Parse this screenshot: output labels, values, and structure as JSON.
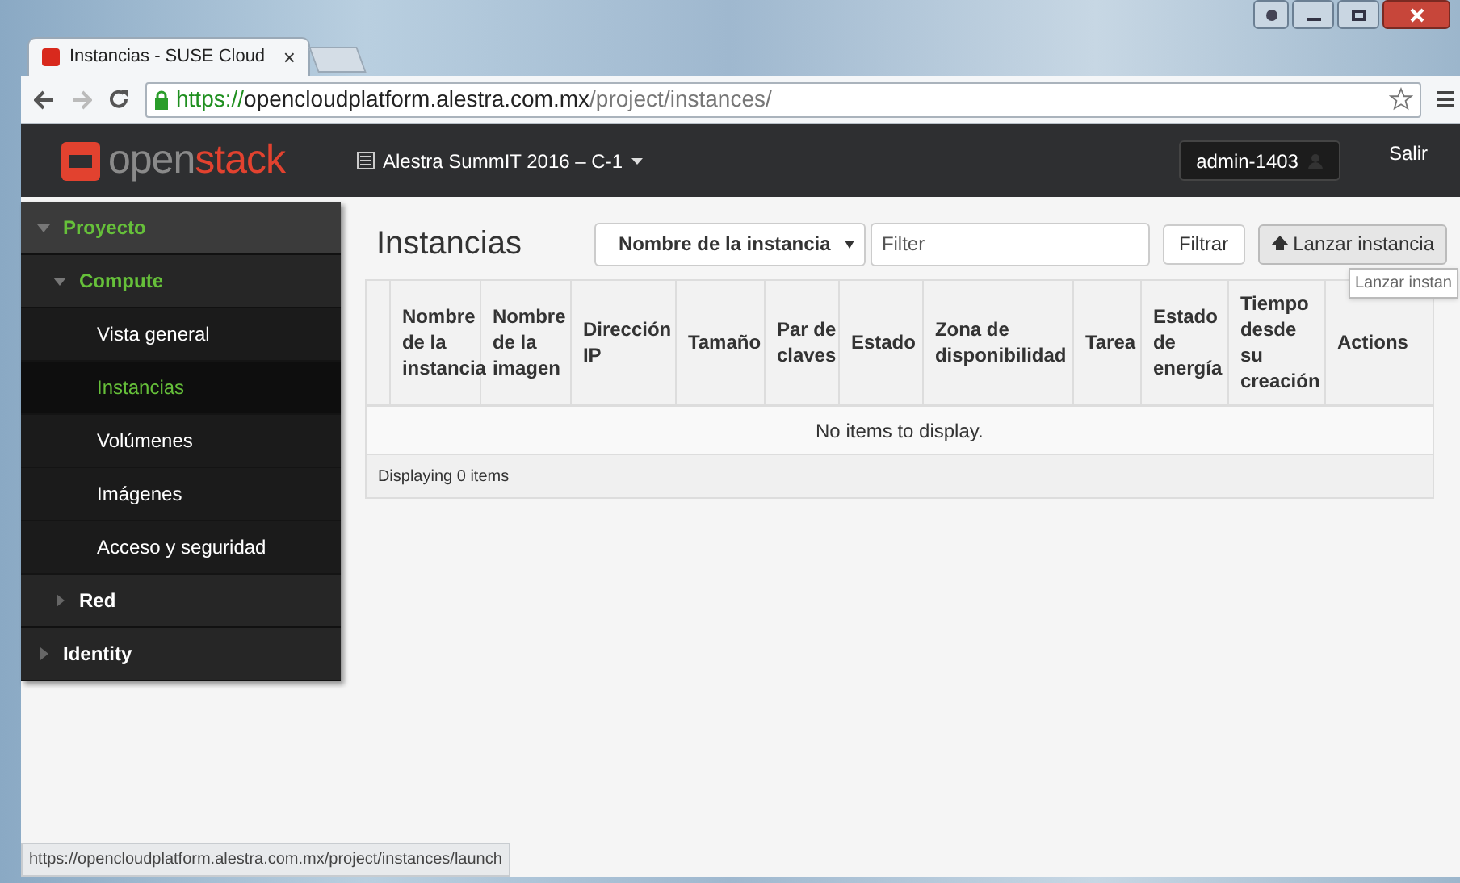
{
  "browser": {
    "tab": {
      "title": "Instancias - SUSE Cloud",
      "close": "×"
    },
    "url": {
      "scheme": "https://",
      "host": "opencloudplatform.alestra.com.mx",
      "path": "/project/instances/"
    },
    "status_url": "https://opencloudplatform.alestra.com.mx/project/instances/launch"
  },
  "header": {
    "logo": {
      "part_1": "open",
      "part_2": "stack"
    },
    "project": "Alestra SummIT 2016 – C-1",
    "user": "admin-1403",
    "logout": "Salir"
  },
  "sidebar": {
    "items": [
      {
        "label": "Proyecto",
        "expanded": true,
        "children": [
          {
            "label": "Compute",
            "expanded": true,
            "children": [
              {
                "label": "Vista general",
                "selected": false
              },
              {
                "label": "Instancias",
                "selected": true
              },
              {
                "label": "Volúmenes",
                "selected": false
              },
              {
                "label": "Imágenes",
                "selected": false
              },
              {
                "label": "Acceso y seguridad",
                "selected": false
              }
            ]
          },
          {
            "label": "Red",
            "expanded": false
          }
        ]
      },
      {
        "label": "Identity",
        "expanded": false
      }
    ]
  },
  "page": {
    "title": "Instancias",
    "filter_select": "Nombre de la instancia",
    "filter": {
      "placeholder": "Filter"
    },
    "filter_button": "Filtrar",
    "launch_button": "Lanzar instancia",
    "tooltip": "Lanzar instan"
  },
  "table": {
    "columns": [
      "Nombre de la instancia",
      "Nombre de la imagen",
      "Dirección IP",
      "Tamaño",
      "Par de claves",
      "Estado",
      "Zona de disponibilidad",
      "Tarea",
      "Estado de energía",
      "Tiempo desde su creación",
      "Actions"
    ],
    "empty_message": "No items to display.",
    "footer": "Displaying 0 items"
  }
}
